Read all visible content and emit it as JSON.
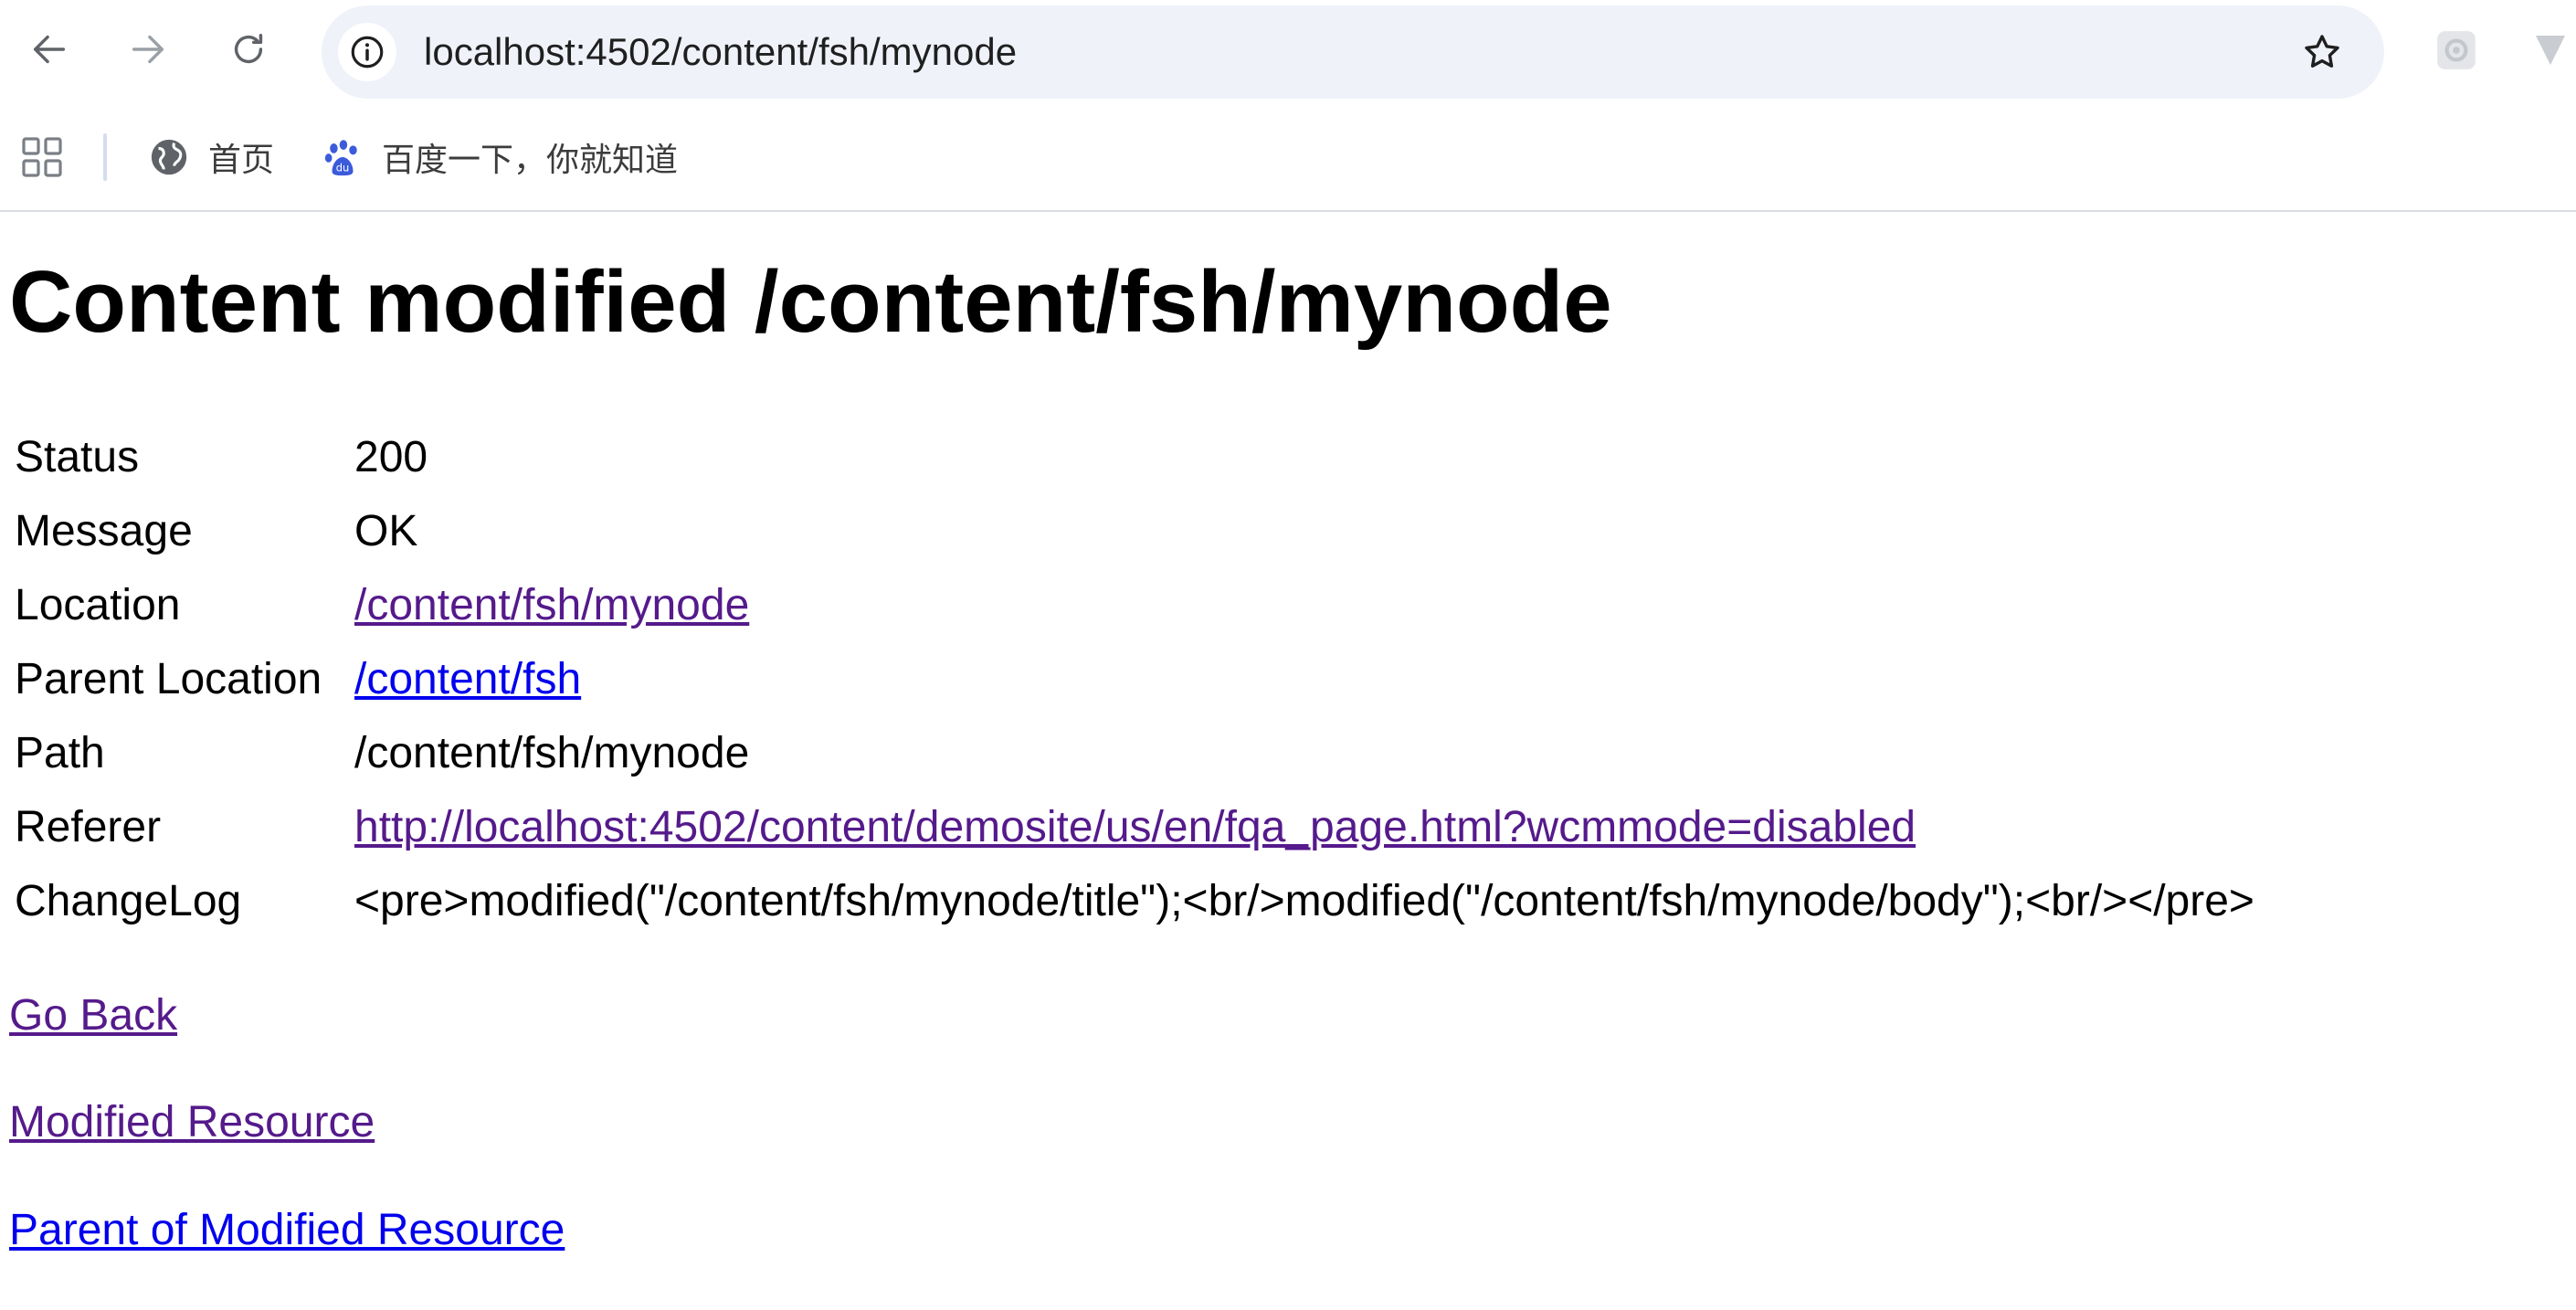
{
  "browser": {
    "url": "localhost:4502/content/fsh/mynode",
    "bookmarks": [
      {
        "label": "首页",
        "icon": "globe-icon"
      },
      {
        "label": "百度一下，你就知道",
        "icon": "baidu-paw-icon"
      }
    ]
  },
  "page": {
    "title": "Content modified /content/fsh/mynode",
    "rows": [
      {
        "label": "Status",
        "value": "200",
        "link": false
      },
      {
        "label": "Message",
        "value": "OK",
        "link": false
      },
      {
        "label": "Location",
        "value": "/content/fsh/mynode",
        "link": true
      },
      {
        "label": "Parent Location",
        "value": "/content/fsh",
        "link": true
      },
      {
        "label": "Path",
        "value": "/content/fsh/mynode",
        "link": false
      },
      {
        "label": "Referer",
        "value": "http://localhost:4502/content/demosite/us/en/fqa_page.html?wcmmode=disabled",
        "link": true
      },
      {
        "label": "ChangeLog",
        "value": "<pre>modified(\"/content/fsh/mynode/title\");<br/>modified(\"/content/fsh/mynode/body\");<br/></pre>",
        "link": false
      }
    ],
    "links": {
      "go_back": "Go Back",
      "modified_resource": "Modified Resource",
      "parent_of_modified_resource": "Parent of Modified Resource"
    }
  },
  "colors": {
    "link_visited": "#551a8b",
    "link_unvisited": "#0000ee",
    "omnibox_bg": "#eff2f9"
  }
}
